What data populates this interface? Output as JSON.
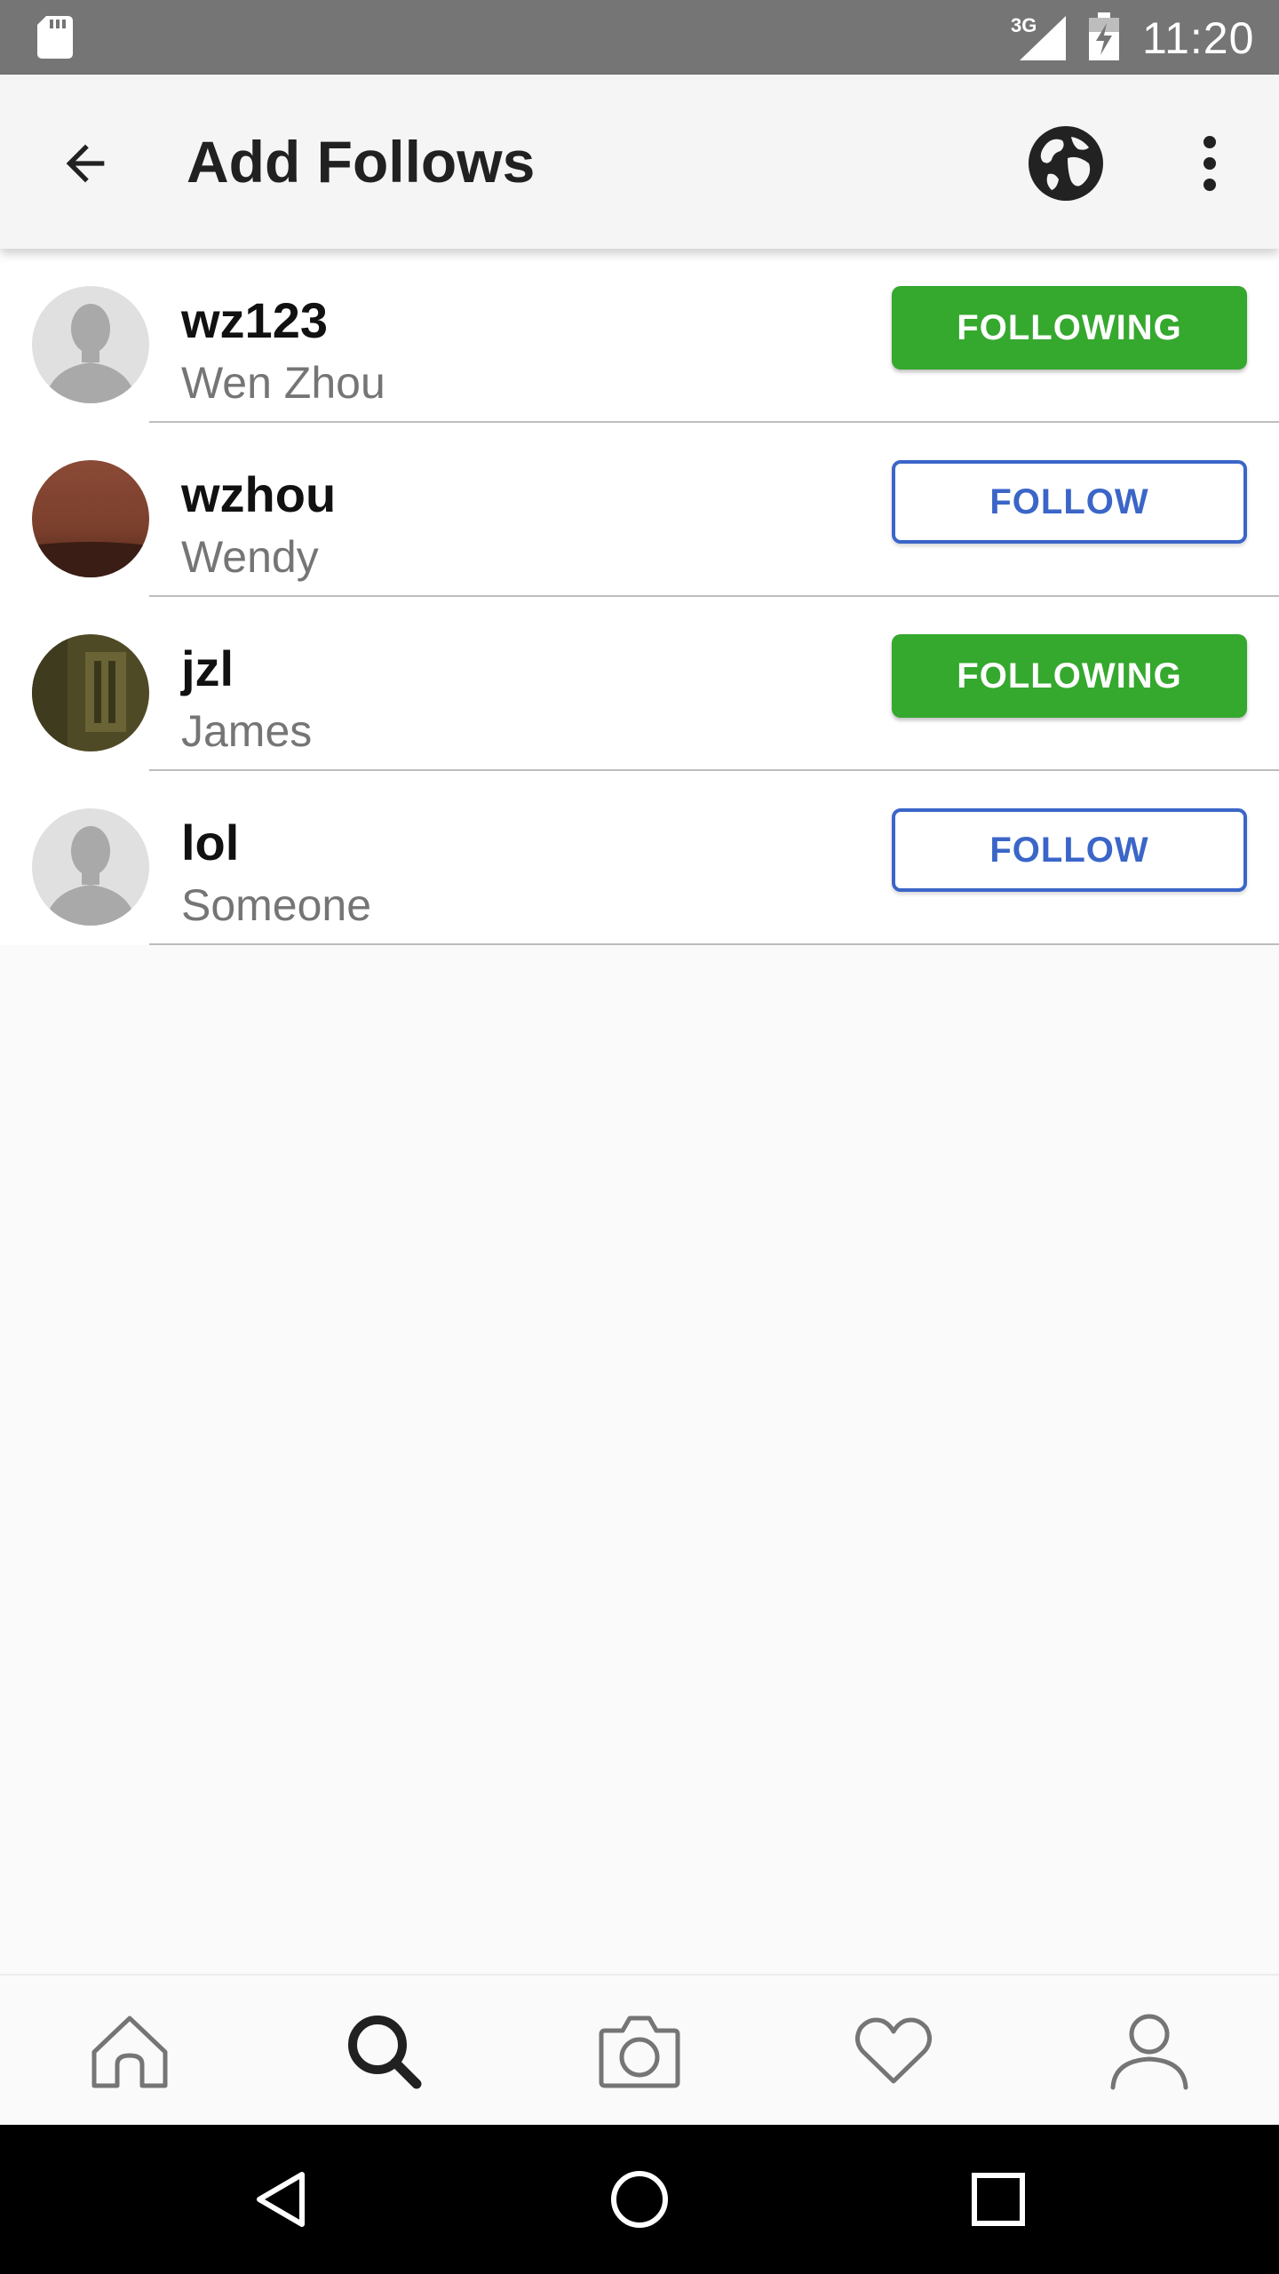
{
  "status_bar": {
    "time": "11:20",
    "network": "3G",
    "icons": [
      "sd-card-icon",
      "signal-icon",
      "battery-charging-icon"
    ]
  },
  "app_bar": {
    "title": "Add Follows",
    "icons": [
      "back-arrow-icon",
      "globe-icon",
      "more-vert-icon"
    ]
  },
  "users": [
    {
      "username": "wz123",
      "fullname": "Wen Zhou",
      "button": "FOLLOWING",
      "avatar": "default-avatar"
    },
    {
      "username": "wzhou",
      "fullname": "Wendy",
      "button": "FOLLOW",
      "avatar": "photo-brown"
    },
    {
      "username": "jzl",
      "fullname": "James",
      "button": "FOLLOWING",
      "avatar": "photo-olive"
    },
    {
      "username": "lol",
      "fullname": "Someone",
      "button": "FOLLOW",
      "avatar": "default-avatar"
    }
  ],
  "bottom_nav": {
    "items": [
      "home-icon",
      "search-icon",
      "camera-icon",
      "heart-icon",
      "profile-icon"
    ],
    "active": "search-icon"
  },
  "system_nav": [
    "back-triangle-icon",
    "home-circle-icon",
    "recents-square-icon"
  ],
  "colors": {
    "following_bg": "#35a82e",
    "follow_accent": "#3b66c8",
    "status_bar": "#757575",
    "app_bar": "#f5f5f5"
  }
}
